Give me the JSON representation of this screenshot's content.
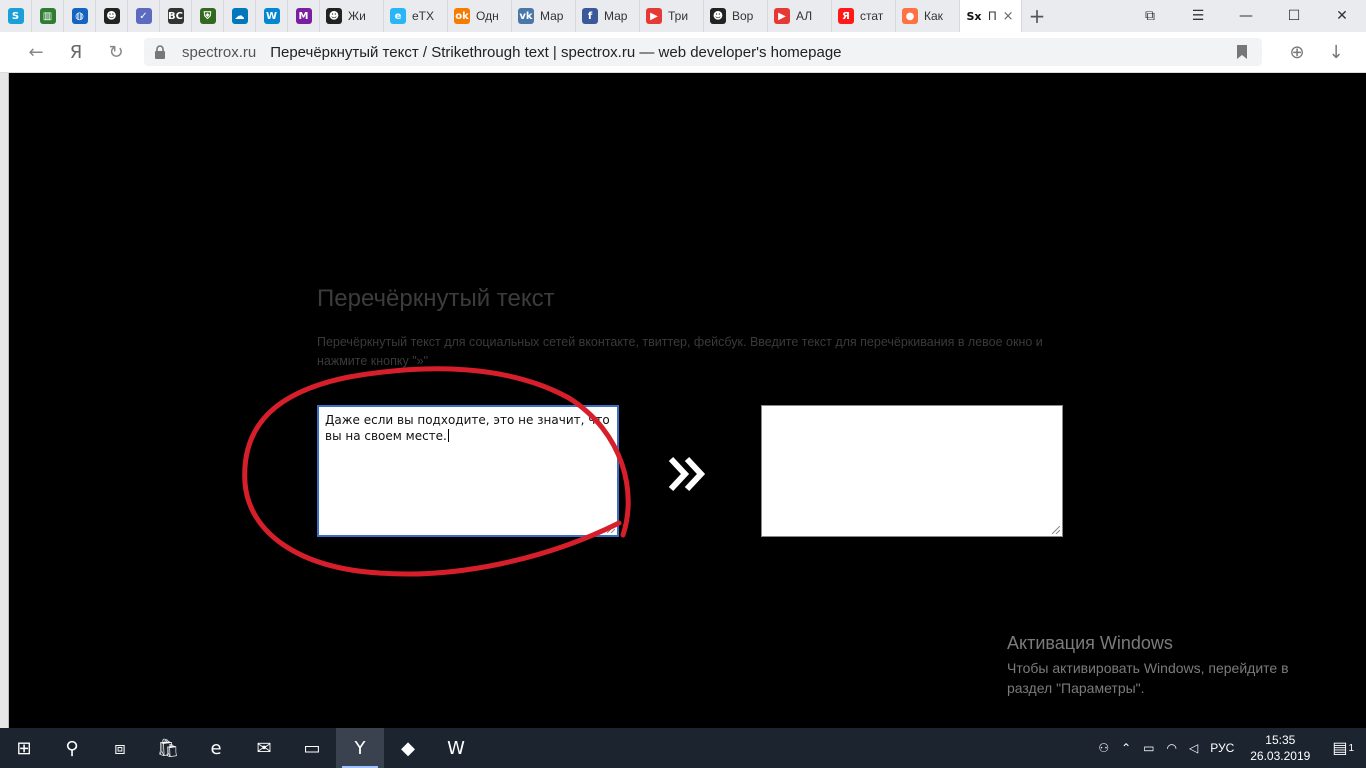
{
  "browser": {
    "pinned_tabs": [
      {
        "icon": "s-icon",
        "glyph": "S",
        "color": "#1a9fd9"
      },
      {
        "icon": "bookshelf-icon",
        "glyph": "▥",
        "color": "#2e7d32"
      },
      {
        "icon": "globe-icon",
        "glyph": "◍",
        "color": "#1565c0"
      },
      {
        "icon": "face-icon",
        "glyph": "☻",
        "color": "#222222"
      },
      {
        "icon": "check-icon",
        "glyph": "✓",
        "color": "#5c6bc0"
      },
      {
        "icon": "bc-icon",
        "glyph": "BC",
        "color": "#333333"
      },
      {
        "icon": "shield-icon",
        "glyph": "⛨",
        "color": "#33691e"
      },
      {
        "icon": "weather-icon",
        "glyph": "☁",
        "color": "#0277bd"
      },
      {
        "icon": "w-icon",
        "glyph": "W",
        "color": "#0288d1"
      },
      {
        "icon": "m-icon",
        "glyph": "M",
        "color": "#7b1fa2"
      }
    ],
    "tabs": [
      {
        "icon": "face-icon",
        "glyph": "☻",
        "color": "#222222",
        "label": "Жи"
      },
      {
        "icon": "etx-icon",
        "glyph": "e",
        "color": "#29b6f6",
        "label": "eTX"
      },
      {
        "icon": "ok-icon",
        "glyph": "ok",
        "color": "#f57c00",
        "label": "Одн"
      },
      {
        "icon": "vk-icon",
        "glyph": "vk",
        "color": "#4a76a8",
        "label": "Мар"
      },
      {
        "icon": "facebook-icon",
        "glyph": "f",
        "color": "#3b5998",
        "label": "Мар"
      },
      {
        "icon": "youtube-icon",
        "glyph": "▶",
        "color": "#e53935",
        "label": "Три"
      },
      {
        "icon": "face-icon",
        "glyph": "☻",
        "color": "#222222",
        "label": "Вор"
      },
      {
        "icon": "youtube-icon",
        "glyph": "▶",
        "color": "#e53935",
        "label": "АЛ"
      },
      {
        "icon": "yandex-icon",
        "glyph": "Я",
        "color": "#ff1a1a",
        "label": "стат"
      },
      {
        "icon": "orange-icon",
        "glyph": "●",
        "color": "#ff7043",
        "label": "Как"
      }
    ],
    "active_tab": {
      "icon": "sx-icon",
      "glyph": "Sx",
      "label": "П",
      "close": "×"
    },
    "new_tab": "+",
    "window_controls": {
      "tabs_icon": "⧉",
      "menu": "☰",
      "minimize": "—",
      "maximize": "☐",
      "close": "✕"
    },
    "nav": {
      "back": "←",
      "yandex": "Я",
      "reload": "↻"
    },
    "address": {
      "domain": "spectrox.ru",
      "page_title": "Перечёркнутый текст / Strikethrough text | spectrox.ru — web developer's homepage"
    },
    "right": {
      "globe": "⊕",
      "download": "↓"
    }
  },
  "page": {
    "heading": "Перечёркнутый текст",
    "description": "Перечёркнутый текст для социальных сетей вконтакте, твиттер, фейсбук. Введите текст для перечёркивания в левое окно и нажмите кнопку \"»\"",
    "input_text": "Даже если вы подходите, это не значит, что вы на своем месте.",
    "output_text": "",
    "convert_button": "»"
  },
  "watermark": {
    "title": "Активация Windows",
    "text": "Чтобы активировать Windows, перейдите в раздел \"Параметры\"."
  },
  "taskbar": {
    "items": [
      {
        "name": "start-button",
        "glyph": "⊞"
      },
      {
        "name": "search-button",
        "glyph": "⚲"
      },
      {
        "name": "task-view-button",
        "glyph": "⧈"
      },
      {
        "name": "store-button",
        "glyph": "🛍"
      },
      {
        "name": "edge-button",
        "glyph": "e"
      },
      {
        "name": "mail-button",
        "glyph": "✉"
      },
      {
        "name": "explorer-button",
        "glyph": "▭"
      },
      {
        "name": "yandex-browser-button",
        "glyph": "Y"
      },
      {
        "name": "paint-button",
        "glyph": "◆"
      },
      {
        "name": "word-button",
        "glyph": "W"
      }
    ],
    "language": "РУС",
    "time": "15:35",
    "date": "26.03.2019",
    "notifications": "1"
  }
}
